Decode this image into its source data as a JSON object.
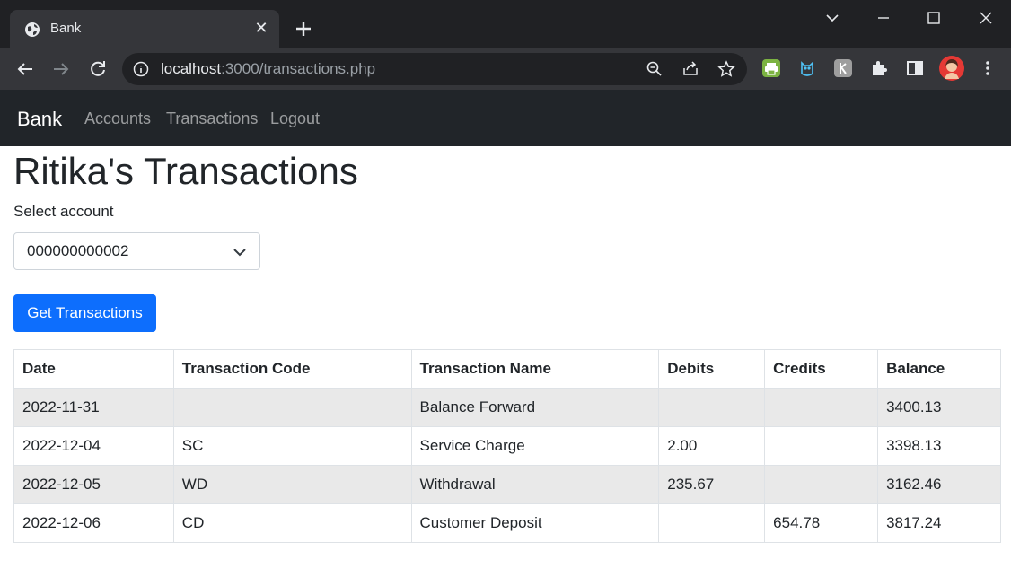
{
  "browser": {
    "tab_title": "Bank",
    "url_host": "localhost",
    "url_path": ":3000/transactions.php"
  },
  "navbar": {
    "brand": "Bank",
    "links": [
      "Accounts",
      "Transactions",
      "Logout"
    ]
  },
  "page": {
    "title": "Ritika's Transactions",
    "select_label": "Select account",
    "selected_account": "000000000002",
    "button_label": "Get Transactions"
  },
  "table": {
    "headers": [
      "Date",
      "Transaction Code",
      "Transaction Name",
      "Debits",
      "Credits",
      "Balance"
    ],
    "rows": [
      [
        "2022-11-31",
        "",
        "Balance Forward",
        "",
        "",
        "3400.13"
      ],
      [
        "2022-12-04",
        "SC",
        "Service Charge",
        "2.00",
        "",
        "3398.13"
      ],
      [
        "2022-12-05",
        "WD",
        "Withdrawal",
        "235.67",
        "",
        "3162.46"
      ],
      [
        "2022-12-06",
        "CD",
        "Customer Deposit",
        "",
        "654.78",
        "3817.24"
      ]
    ]
  },
  "colors": {
    "navbar_bg": "#212529",
    "primary": "#0d6efd",
    "stripe": "#e9e9e9"
  }
}
